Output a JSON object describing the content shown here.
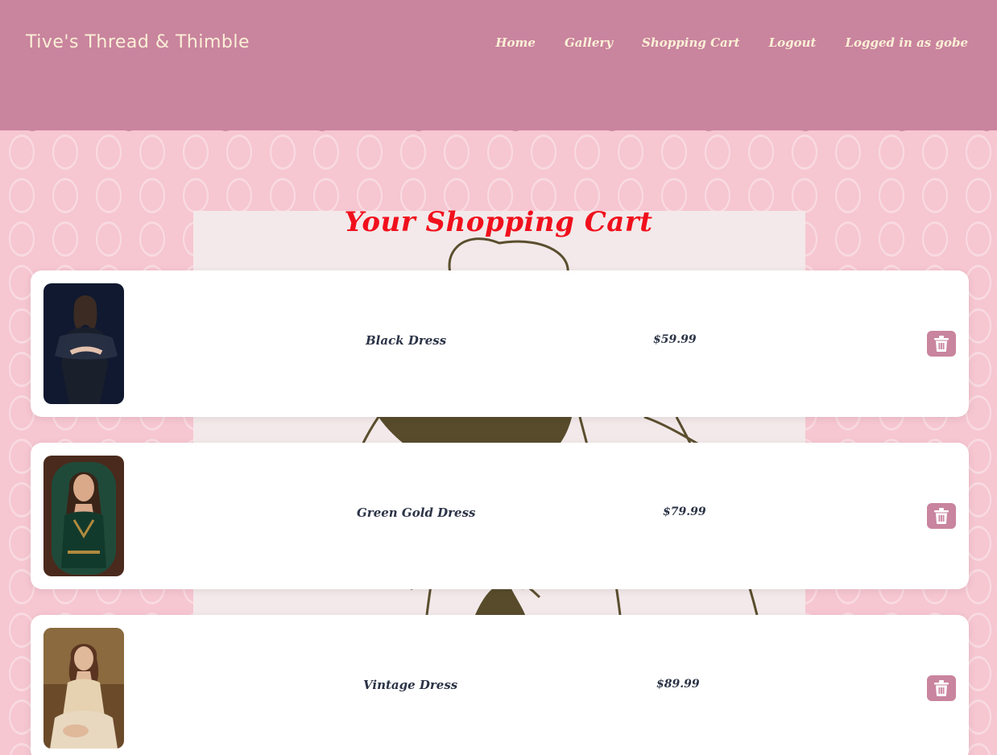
{
  "header": {
    "brand": "Tive's Thread & Thimble",
    "nav": [
      {
        "label": "Home"
      },
      {
        "label": "Gallery"
      },
      {
        "label": "Shopping Cart"
      },
      {
        "label": "Logout"
      },
      {
        "label": "Logged in as gobe"
      }
    ]
  },
  "main": {
    "title": "Your Shopping Cart",
    "items": [
      {
        "name": "Black Dress",
        "price": "$59.99",
        "delete_icon": "trash-icon"
      },
      {
        "name": "Green Gold Dress",
        "price": "$79.99",
        "delete_icon": "trash-icon"
      },
      {
        "name": "Vintage Dress",
        "price": "$89.99",
        "delete_icon": "trash-icon"
      }
    ]
  },
  "colors": {
    "header_bg": "#c9849e",
    "header_text": "#fbf0d6",
    "page_bg": "#f6c6d1",
    "title": "#f0101c",
    "card_bg": "#ffffff",
    "item_text": "#2b3346",
    "delete_button": "#c9849e"
  }
}
